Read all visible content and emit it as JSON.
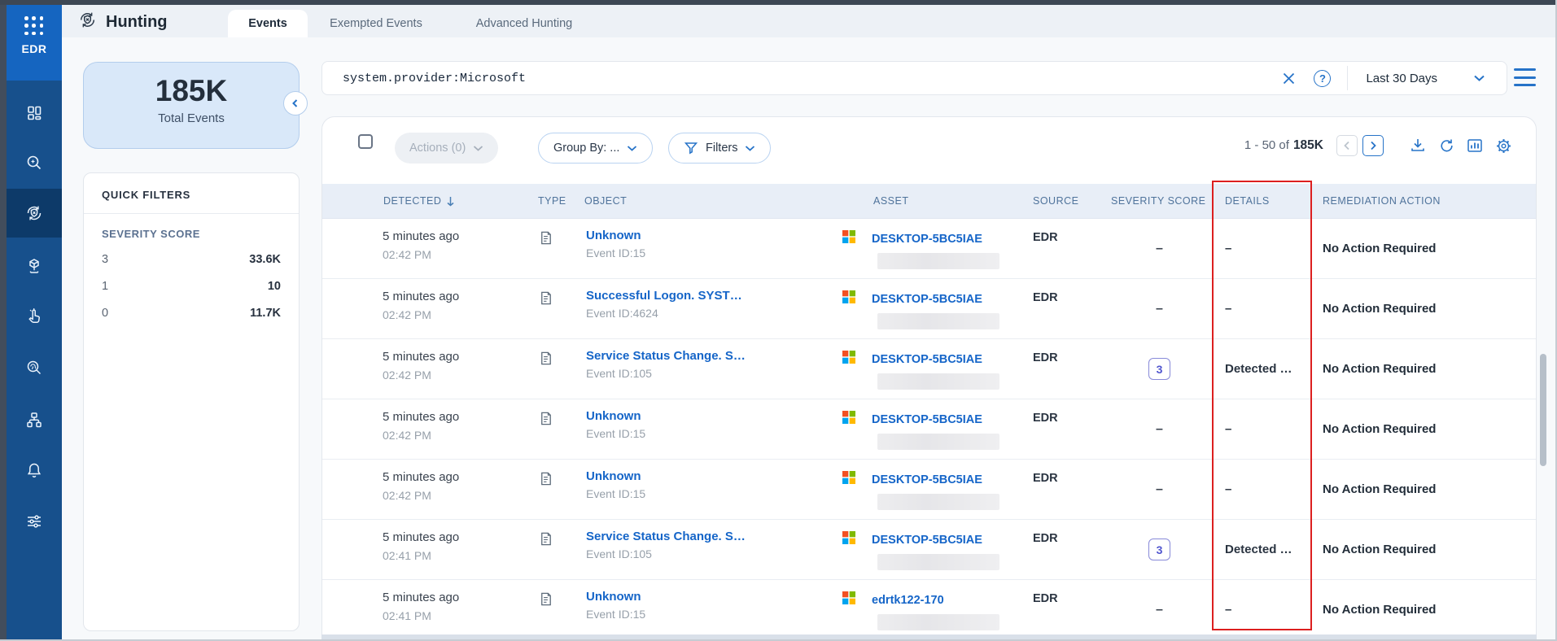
{
  "sidebar": {
    "product": "EDR",
    "items": [
      {
        "name": "dashboard"
      },
      {
        "name": "investigation-search"
      },
      {
        "name": "hunting",
        "active": true
      },
      {
        "name": "asset-inventory"
      },
      {
        "name": "response-actions"
      },
      {
        "name": "forensics"
      },
      {
        "name": "topology"
      },
      {
        "name": "notifications"
      },
      {
        "name": "settings"
      }
    ]
  },
  "header": {
    "title": "Hunting",
    "tabs": [
      {
        "label": "Events",
        "active": true
      },
      {
        "label": "Exempted Events",
        "active": false
      },
      {
        "label": "Advanced Hunting",
        "active": false
      }
    ]
  },
  "summary": {
    "total_value": "185K",
    "total_label": "Total Events"
  },
  "quick_filters": {
    "title": "QUICK FILTERS",
    "sections": [
      {
        "title": "SEVERITY SCORE",
        "rows": [
          {
            "label": "3",
            "value": "33.6K"
          },
          {
            "label": "1",
            "value": "10"
          },
          {
            "label": "0",
            "value": "11.7K"
          }
        ]
      }
    ]
  },
  "search": {
    "query": "system.provider:Microsoft",
    "date_range": "Last 30 Days",
    "help_glyph": "?"
  },
  "toolbar": {
    "actions_label": "Actions (0)",
    "group_by_label": "Group By: ...",
    "filters_label": "Filters",
    "range_text": "1 - 50 of",
    "range_total": "185K"
  },
  "table": {
    "columns": [
      "DETECTED",
      "TYPE",
      "OBJECT",
      "ASSET",
      "SOURCE",
      "SEVERITY SCORE",
      "DETAILS",
      "REMEDIATION ACTION"
    ],
    "sort": {
      "column": "DETECTED",
      "direction": "desc"
    },
    "empty_value": "–",
    "rows": [
      {
        "ago": "5 minutes ago",
        "time": "02:42 PM",
        "object": "Unknown",
        "object_sub": "Event ID:15",
        "asset": "DESKTOP-5BC5IAE",
        "source": "EDR",
        "severity": "",
        "details": "–",
        "action": "No Action Required"
      },
      {
        "ago": "5 minutes ago",
        "time": "02:42 PM",
        "object": "Successful Logon. SYST…",
        "object_sub": "Event ID:4624",
        "asset": "DESKTOP-5BC5IAE",
        "source": "EDR",
        "severity": "",
        "details": "–",
        "action": "No Action Required"
      },
      {
        "ago": "5 minutes ago",
        "time": "02:42 PM",
        "object": "Service Status Change. S…",
        "object_sub": "Event ID:105",
        "asset": "DESKTOP-5BC5IAE",
        "source": "EDR",
        "severity": "3",
        "details": "Detected …",
        "action": "No Action Required"
      },
      {
        "ago": "5 minutes ago",
        "time": "02:42 PM",
        "object": "Unknown",
        "object_sub": "Event ID:15",
        "asset": "DESKTOP-5BC5IAE",
        "source": "EDR",
        "severity": "",
        "details": "–",
        "action": "No Action Required"
      },
      {
        "ago": "5 minutes ago",
        "time": "02:42 PM",
        "object": "Unknown",
        "object_sub": "Event ID:15",
        "asset": "DESKTOP-5BC5IAE",
        "source": "EDR",
        "severity": "",
        "details": "–",
        "action": "No Action Required"
      },
      {
        "ago": "5 minutes ago",
        "time": "02:41 PM",
        "object": "Service Status Change. S…",
        "object_sub": "Event ID:105",
        "asset": "DESKTOP-5BC5IAE",
        "source": "EDR",
        "severity": "3",
        "details": "Detected …",
        "action": "No Action Required"
      },
      {
        "ago": "5 minutes ago",
        "time": "02:41 PM",
        "object": "Unknown",
        "object_sub": "Event ID:15",
        "asset": "edrtk122-170",
        "source": "EDR",
        "severity": "",
        "details": "–",
        "action": "No Action Required"
      }
    ]
  },
  "colors": {
    "accent_blue": "#1565c8",
    "icon_blue": "#2673c8",
    "sidebar_blue": "#17508c",
    "sidebar_top_blue": "#1565c0",
    "sidebar_active": "#0d3a69",
    "header_bg": "#e8eef7",
    "annotation_red": "#dc1f1f",
    "severity_badge": "#5156cf",
    "ms_logo": [
      "#f25022",
      "#7fba00",
      "#00a4ef",
      "#ffb900"
    ]
  }
}
